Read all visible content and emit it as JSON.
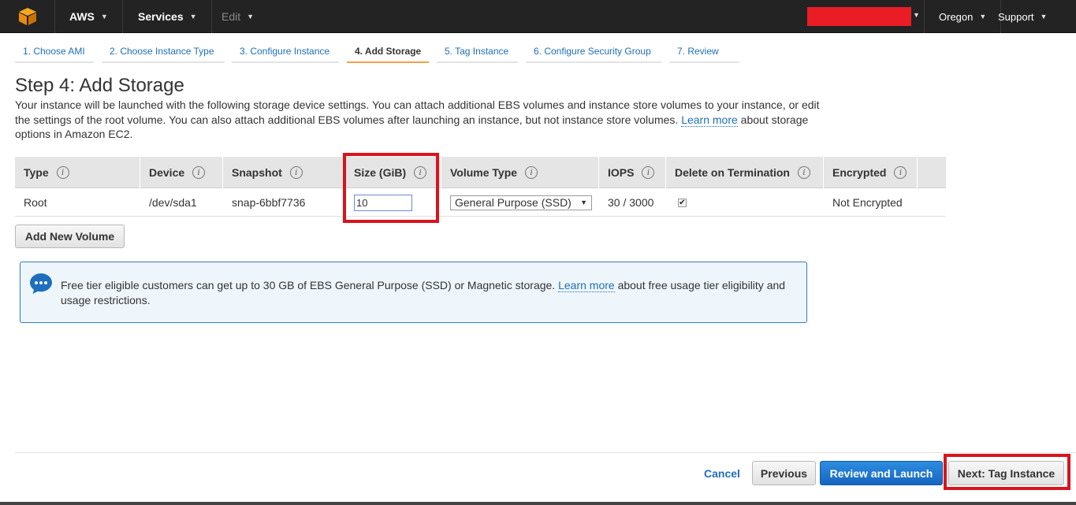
{
  "topnav": {
    "aws_label": "AWS",
    "services_label": "Services",
    "edit_label": "Edit",
    "region_label": "Oregon",
    "support_label": "Support",
    "colors": {
      "bg": "#232323",
      "redacted": "#ea1c24"
    }
  },
  "steps": [
    {
      "label": "1. Choose AMI"
    },
    {
      "label": "2. Choose Instance Type"
    },
    {
      "label": "3. Configure Instance"
    },
    {
      "label": "4. Add Storage",
      "active": true
    },
    {
      "label": "5. Tag Instance"
    },
    {
      "label": "6. Configure Security Group"
    },
    {
      "label": "7. Review"
    }
  ],
  "page": {
    "title": "Step 4: Add Storage",
    "description_pre": "Your instance will be launched with the following storage device settings. You can attach additional EBS volumes and instance store volumes to your instance, or edit the settings of the root volume. You can also attach additional EBS volumes after launching an instance, but not instance store volumes.",
    "description_link": "Learn more",
    "description_post": "about storage options in Amazon EC2."
  },
  "table": {
    "headers": [
      "Type",
      "Device",
      "Snapshot",
      "Size (GiB)",
      "Volume Type",
      "IOPS",
      "Delete on Termination",
      "Encrypted"
    ],
    "row": {
      "type": "Root",
      "device": "/dev/sda1",
      "snapshot": "snap-6bbf7736",
      "size": "10",
      "volume_type": "General Purpose (SSD)",
      "iops": "30 / 3000",
      "delete_on_termination": true,
      "encrypted": "Not Encrypted"
    }
  },
  "add_volume_label": "Add New Volume",
  "infobox": {
    "text_pre": "Free tier eligible customers can get up to 30 GB of EBS General Purpose (SSD) or Magnetic storage.",
    "link": "Learn more",
    "text_post": "about free usage tier eligibility and usage restrictions."
  },
  "footer": {
    "cancel_label": "Cancel",
    "previous_label": "Previous",
    "review_label": "Review and Launch",
    "next_label": "Next: Tag Instance"
  },
  "colors": {
    "accent_blue": "#1e6fb8",
    "highlight_red": "#d8141d",
    "active_step": "#f0a04b",
    "info_bg": "#eef6fc"
  }
}
